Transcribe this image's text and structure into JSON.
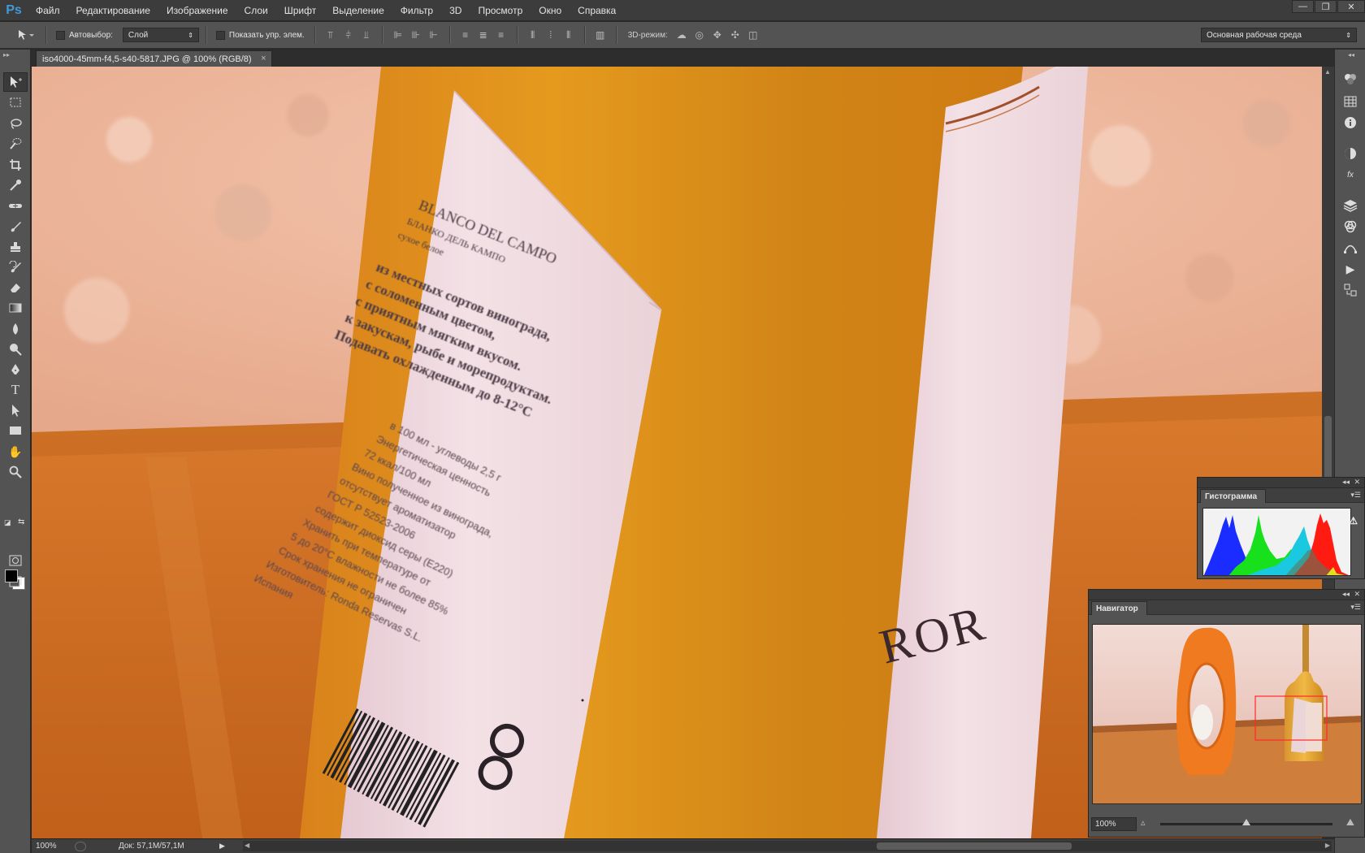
{
  "app": {
    "logo": "Ps"
  },
  "menu": [
    "Файл",
    "Редактирование",
    "Изображение",
    "Слои",
    "Шрифт",
    "Выделение",
    "Фильтр",
    "3D",
    "Просмотр",
    "Окно",
    "Справка"
  ],
  "window_controls": {
    "minimize": "—",
    "restore": "❐",
    "close": "✕"
  },
  "options": {
    "move_icon": "move-tool-icon",
    "autoselect_label": "Автовыбор:",
    "autoselect_value": "Слой",
    "show_transform_label": "Показать упр. элем.",
    "mode_3d_label": "3D-режим:",
    "workspace_value": "Основная рабочая среда"
  },
  "document": {
    "tab_title": "iso4000-45mm-f4,5-s40-5817.JPG @ 100% (RGB/8)",
    "close": "×"
  },
  "label_text": {
    "line1": "BLANCO DEL CAMPO",
    "line2": "БЛАНКО ДЕЛЬ КАМПО",
    "line3": "сухое белое",
    "body": [
      "из местных сортов винограда,",
      "с соломенным цветом,",
      "с приятным мягким вкусом.",
      "к закускам, рыбе и морепродуктам.",
      "Подавать охлажденным до 8-12°С"
    ],
    "small": [
      "в 100 мл - углеводы 2,5 г",
      "Энергетическая ценность",
      "72 ккал/100 мл",
      "Вино полученное из винограда,",
      "отсутствует ароматизатор",
      "ГОСТ Р 52523-2006",
      "содержит диоксид серы (Е220)",
      "Хранить при температуре от",
      "5 до 20°С влажности не более 85%",
      "Срок хранения не ограничен",
      "Изготовитель: Ronda Reservas S.L.",
      "Испания"
    ],
    "brand": "ROR"
  },
  "status": {
    "zoom": "100%",
    "doc_size": "Док: 57,1M/57,1M"
  },
  "histogram": {
    "title": "Гистограмма",
    "warning": "⚠"
  },
  "navigator": {
    "title": "Навигатор",
    "zoom": "100%"
  },
  "colors": {
    "foreground": "#000000",
    "background": "#ffffff",
    "accent": "#3f9bd8"
  }
}
